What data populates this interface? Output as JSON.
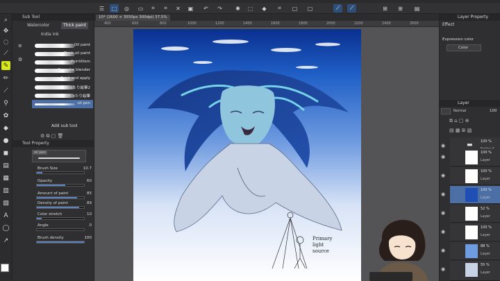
{
  "window": {
    "tab_title": "10* (2600 × 3550px 300dpi) 37.5%"
  },
  "ruler": {
    "ticks": [
      "400",
      "600",
      "800",
      "1000",
      "1200",
      "1400",
      "1600",
      "1800",
      "2000",
      "2200",
      "2400",
      "2600"
    ]
  },
  "subtool": {
    "header": "Sub Tool",
    "tabs": [
      "Watercolor",
      "Thick paint",
      "India ink"
    ],
    "active_tab": "Thick paint",
    "brushes": [
      "Oil paint",
      "Thick oil paint",
      "Pointillism",
      "Gouache blender",
      "Paint and apply",
      "べったり絵筆2",
      "べったり絵筆",
      "oil pen"
    ],
    "active_brush": "oil pen",
    "add_label": "Add sub tool"
  },
  "toolprop": {
    "header": "Tool Property",
    "preset_name": "oil pen",
    "rows": [
      {
        "name": "Brush Size",
        "value": "10.7",
        "fraction": 0.12
      },
      {
        "name": "Opacity",
        "value": "60",
        "fraction": 0.6
      },
      {
        "name": "Amount of paint",
        "value": "85",
        "fraction": 0.85
      },
      {
        "name": "Density of paint",
        "value": "89",
        "fraction": 0.89
      },
      {
        "name": "Color stretch",
        "value": "10",
        "fraction": 0.1
      },
      {
        "name": "Angle",
        "value": "0",
        "fraction": 0.0
      },
      {
        "name": "Brush density",
        "value": "100",
        "fraction": 1.0
      }
    ]
  },
  "layer_property": {
    "header": "Layer Property",
    "effect_label": "Effect",
    "expression_label": "Expression color",
    "color_value": "Color"
  },
  "layer_panel": {
    "header": "Layer",
    "blend": "Normal",
    "opacity": "100",
    "layers": [
      {
        "pct": "100 %",
        "name": "Folder 5"
      },
      {
        "pct": "100 %",
        "name": "Layer"
      },
      {
        "pct": "100 %",
        "name": "Layer"
      },
      {
        "pct": "100 %",
        "name": "Layer"
      },
      {
        "pct": "52 %",
        "name": "Layer"
      },
      {
        "pct": "100 %",
        "name": "Layer"
      },
      {
        "pct": "88 %",
        "name": "Layer"
      },
      {
        "pct": "55 %",
        "name": "Layer"
      }
    ],
    "selected_index": 3
  },
  "sketch_note": [
    "Primary",
    "light",
    "source"
  ],
  "colors": {
    "accent": "#4c6fa5",
    "tool_active": "#d6e81a"
  }
}
